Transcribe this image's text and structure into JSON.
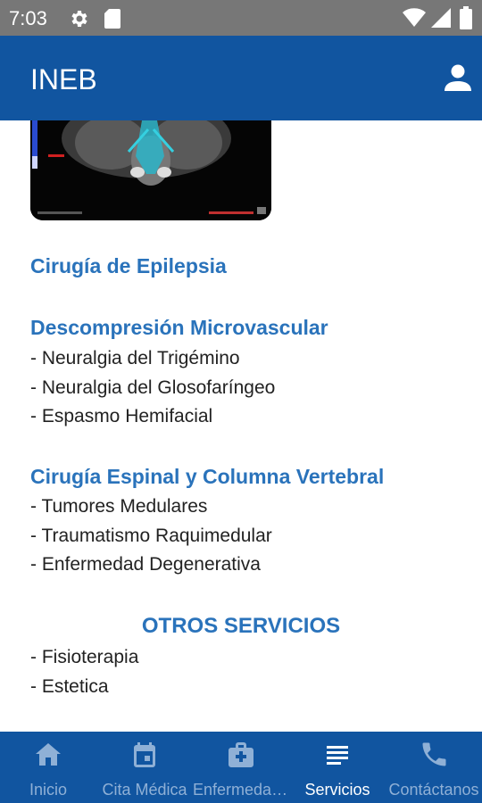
{
  "status_bar": {
    "time": "7:03",
    "icons": [
      "settings-icon",
      "sd-card-icon",
      "wifi-icon",
      "signal-icon",
      "battery-icon"
    ]
  },
  "app_bar": {
    "title": "INEB",
    "action_icon": "account-icon"
  },
  "sections": [
    {
      "title": "Cirugía de Epilepsia",
      "items": []
    },
    {
      "title": "Descompresión Microvascular",
      "items": [
        "- Neuralgia del Trigémino",
        "- Neuralgia del Glosofaríngeo",
        "- Espasmo Hemifacial"
      ]
    },
    {
      "title": "Cirugía Espinal y Columna Vertebral",
      "items": [
        "- Tumores Medulares",
        "- Traumatismo Raquimedular",
        "- Enfermedad Degenerativa"
      ]
    }
  ],
  "otros": {
    "title": "OTROS SERVICIOS",
    "items": [
      "- Fisioterapia",
      "- Estetica"
    ]
  },
  "bottom_nav": {
    "items": [
      {
        "label": "Inicio",
        "icon": "home-icon",
        "active": false
      },
      {
        "label": "Cita Médica",
        "icon": "calendar-icon",
        "active": false
      },
      {
        "label": "Enfermedades",
        "icon": "medical-kit-icon",
        "active": false
      },
      {
        "label": "Servicios",
        "icon": "list-icon",
        "active": true
      },
      {
        "label": "Contáctanos",
        "icon": "phone-icon",
        "active": false
      }
    ]
  },
  "colors": {
    "primary": "#1155a0",
    "accent_text": "#2a73bb",
    "status_bar": "#777777",
    "nav_inactive": "#8fb0d6"
  }
}
